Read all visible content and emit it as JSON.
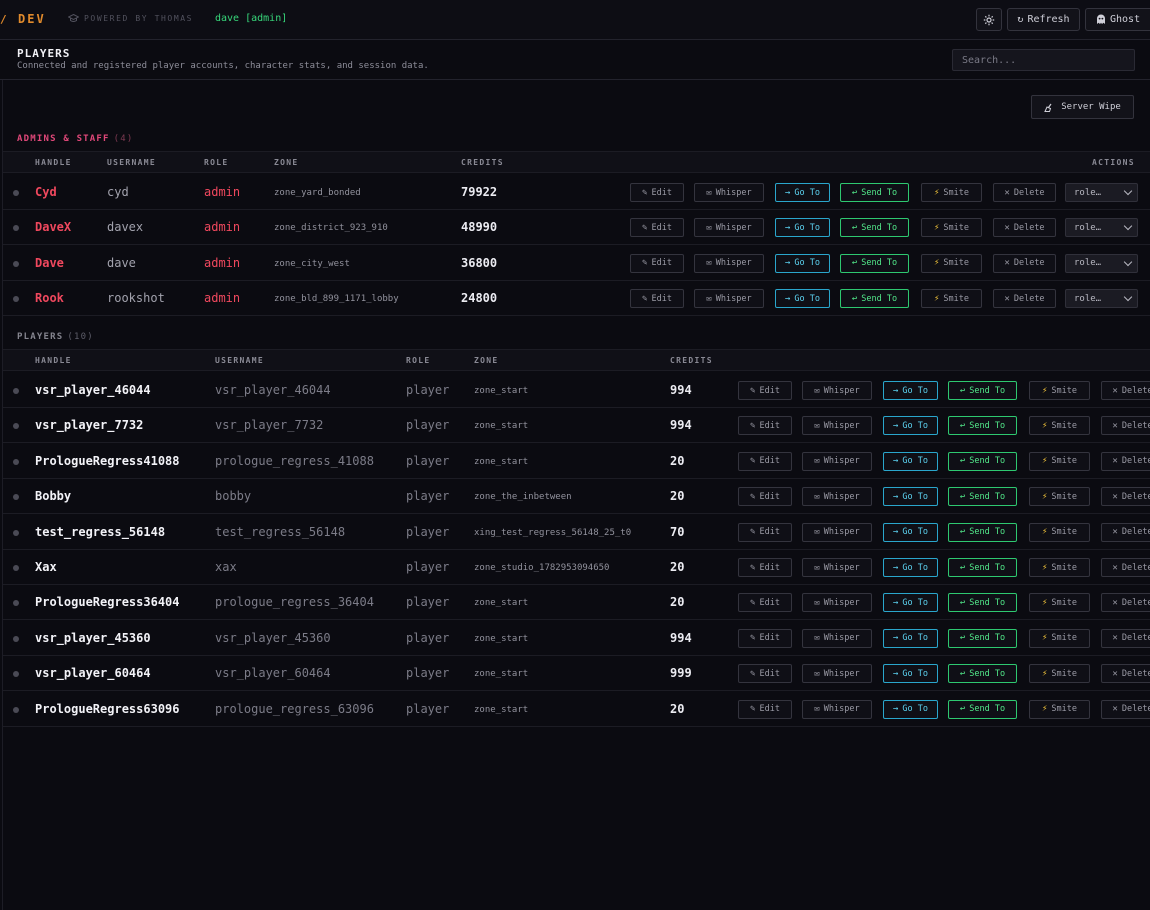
{
  "topbar": {
    "brand_edge": "/",
    "brand": "DEV",
    "powered": "POWERED BY THOMAS",
    "user": "dave [admin]",
    "refresh_label": "Refresh",
    "ghost_label": "Ghost"
  },
  "header": {
    "title": "PLAYERS",
    "subtitle": "Connected and registered player accounts, character stats, and session data.",
    "search_placeholder": "Search..."
  },
  "toolbar": {
    "server_wipe_label": "Server Wipe"
  },
  "admins": {
    "label": "ADMINS & STAFF",
    "count": "(4)",
    "columns": {
      "handle": "HANDLE",
      "username": "USERNAME",
      "role": "ROLE",
      "zone": "ZONE",
      "credits": "CREDITS",
      "actions": "ACTIONS"
    },
    "rows": [
      {
        "handle": "Cyd",
        "username": "cyd",
        "role": "admin",
        "zone": "zone_yard_bonded",
        "credits": "79922"
      },
      {
        "handle": "DaveX",
        "username": "davex",
        "role": "admin",
        "zone": "zone_district_923_910",
        "credits": "48990"
      },
      {
        "handle": "Dave",
        "username": "dave",
        "role": "admin",
        "zone": "zone_city_west",
        "credits": "36800"
      },
      {
        "handle": "Rook",
        "username": "rookshot",
        "role": "admin",
        "zone": "zone_bld_899_1171_lobby",
        "credits": "24800"
      }
    ]
  },
  "players": {
    "label": "PLAYERS",
    "count": "(10)",
    "columns": {
      "handle": "HANDLE",
      "username": "USERNAME",
      "role": "ROLE",
      "zone": "ZONE",
      "credits": "CREDITS"
    },
    "rows": [
      {
        "handle": "vsr_player_46044",
        "username": "vsr_player_46044",
        "role": "player",
        "zone": "zone_start",
        "credits": "994"
      },
      {
        "handle": "vsr_player_7732",
        "username": "vsr_player_7732",
        "role": "player",
        "zone": "zone_start",
        "credits": "994"
      },
      {
        "handle": "PrologueRegress41088",
        "username": "prologue_regress_41088",
        "role": "player",
        "zone": "zone_start",
        "credits": "20"
      },
      {
        "handle": "Bobby",
        "username": "bobby",
        "role": "player",
        "zone": "zone_the_inbetween",
        "credits": "20"
      },
      {
        "handle": "test_regress_56148",
        "username": "test_regress_56148",
        "role": "player",
        "zone": "xing_test_regress_56148_25_t0",
        "credits": "70"
      },
      {
        "handle": "Xax",
        "username": "xax",
        "role": "player",
        "zone": "zone_studio_1782953094650",
        "credits": "20"
      },
      {
        "handle": "PrologueRegress36404",
        "username": "prologue_regress_36404",
        "role": "player",
        "zone": "zone_start",
        "credits": "20"
      },
      {
        "handle": "vsr_player_45360",
        "username": "vsr_player_45360",
        "role": "player",
        "zone": "zone_start",
        "credits": "994"
      },
      {
        "handle": "vsr_player_60464",
        "username": "vsr_player_60464",
        "role": "player",
        "zone": "zone_start",
        "credits": "999"
      },
      {
        "handle": "PrologueRegress63096",
        "username": "prologue_regress_63096",
        "role": "player",
        "zone": "zone_start",
        "credits": "20"
      }
    ]
  },
  "actions": {
    "edit": "Edit",
    "whisper": "Whisper",
    "goto": "Go To",
    "send": "Send To",
    "smite": "Smite",
    "delete": "Delete",
    "role_select": "role…"
  },
  "icons": {
    "edit": "pencil-icon",
    "whisper": "mail-icon",
    "goto": "arrow-right-icon",
    "send": "return-arrow-icon",
    "smite": "lightning-icon",
    "delete": "x-icon",
    "gear": "gear-icon",
    "refresh": "refresh-icon",
    "ghost": "ghost-icon",
    "wipe": "broom-icon"
  },
  "colors": {
    "accent_orange": "#e08a2c",
    "admin_red": "#f0485e",
    "admin_section_pink": "#e2487a",
    "user_green": "#37d67a",
    "goto_cyan": "#5cd2f0",
    "send_green": "#52e88a",
    "smite_yellow": "#f0c23a"
  }
}
